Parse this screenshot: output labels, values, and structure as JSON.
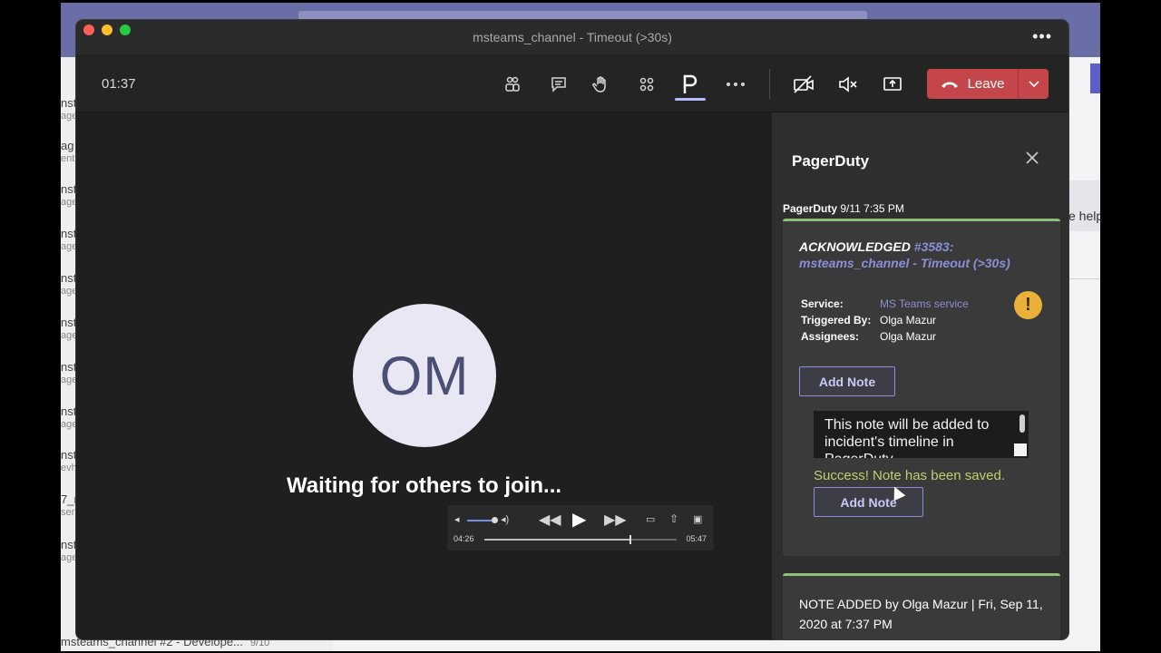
{
  "background": {
    "left_items": [
      {
        "title": "nst",
        "sub": "age"
      },
      {
        "title": "ag",
        "sub": "ent"
      },
      {
        "title": "nst",
        "sub": "age"
      },
      {
        "title": "nst",
        "sub": "age"
      },
      {
        "title": "nst",
        "sub": "age"
      },
      {
        "title": "nst",
        "sub": "age"
      },
      {
        "title": "nst",
        "sub": "age"
      },
      {
        "title": "nst",
        "sub": "age"
      },
      {
        "title": "nst",
        "sub": "evh"
      },
      {
        "title": "7_r",
        "sub": "ser"
      },
      {
        "title": "nst",
        "sub": "age"
      }
    ],
    "bottom_item": "msteams_channel #2 - Develope...",
    "bottom_count": "9/10",
    "right_help": "e help"
  },
  "window": {
    "title": "msteams_channel - Timeout (>30s)",
    "more_label": "•••"
  },
  "toolbar": {
    "timer": "01:37",
    "leave_label": "Leave"
  },
  "stage": {
    "avatar_initials": "OM",
    "waiting_text": "Waiting for others to join..."
  },
  "player": {
    "current_time": "04:26",
    "duration": "05:47",
    "progress": 0.76
  },
  "panel": {
    "title": "PagerDuty",
    "message_sender": "PagerDuty",
    "message_time": "9/11 7:35 PM",
    "card": {
      "status": "ACKNOWLEDGED",
      "incident_link": "#3583: msteams_channel - Timeout (>30s)",
      "service_label": "Service:",
      "service_value": "MS Teams service",
      "triggered_label": "Triggered By:",
      "triggered_value": "Olga Mazur",
      "assignees_label": "Assignees:",
      "assignees_value": "Olga Mazur",
      "add_note_label": "Add Note",
      "note_text": "This note will be added to incident's timeline in PagerDuty",
      "success_text": "Success! Note has been saved.",
      "add_note_label_2": "Add Note"
    },
    "note_added_text": "NOTE ADDED by Olga Mazur | Fri, Sep 11, 2020 at 7:37 PM"
  }
}
